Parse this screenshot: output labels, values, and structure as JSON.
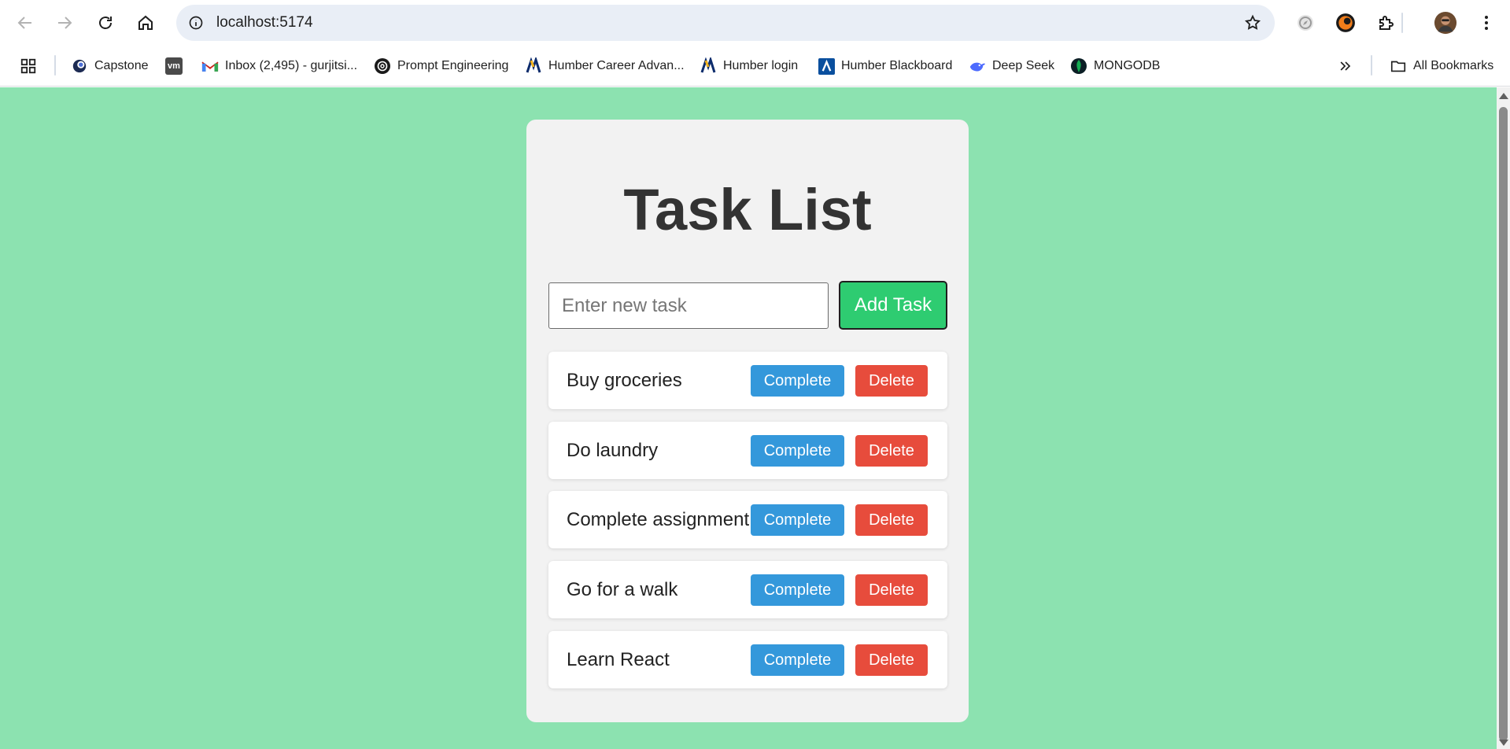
{
  "browser": {
    "url": "localhost:5174",
    "bookmarks": [
      {
        "label": "Capstone",
        "icon": "capstone-icon"
      },
      {
        "label": "",
        "icon": "vm-icon"
      },
      {
        "label": "Inbox (2,495) - gurjitsi...",
        "icon": "gmail-icon"
      },
      {
        "label": "Prompt Engineering",
        "icon": "openai-icon"
      },
      {
        "label": "Humber Career Advan...",
        "icon": "humber-icon"
      },
      {
        "label": "Humber login",
        "icon": "humber-icon"
      },
      {
        "label": "Humber Blackboard",
        "icon": "blackboard-icon"
      },
      {
        "label": "Deep Seek",
        "icon": "deepseek-icon"
      },
      {
        "label": "MONGODB",
        "icon": "mongodb-icon"
      }
    ],
    "vm_badge": "vm",
    "all_bookmarks": "All Bookmarks"
  },
  "app": {
    "title": "Task List",
    "input_placeholder": "Enter new task",
    "add_button": "Add Task",
    "complete_label": "Complete",
    "delete_label": "Delete",
    "tasks": [
      "Buy groceries",
      "Do laundry",
      "Complete assignment",
      "Go for a walk",
      "Learn React"
    ]
  },
  "colors": {
    "page_background": "#8ce2b0",
    "add_button": "#2ecc71",
    "complete_button": "#3498db",
    "delete_button": "#e74c3c"
  }
}
